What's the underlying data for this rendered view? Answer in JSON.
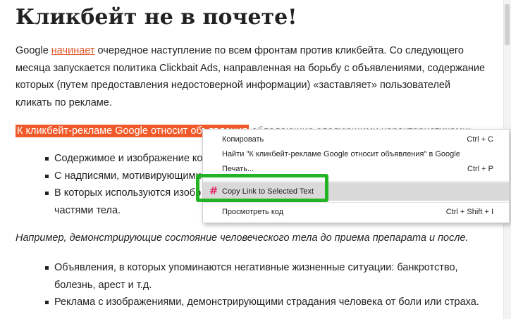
{
  "article": {
    "title": "Кликбейт не в почете!",
    "intro_before_link": "Google ",
    "intro_link": "начинает",
    "intro_after_link": " очередное наступление по всем фронтам против кликбейта. Со следующего месяца запускается политика Clickbait Ads, направленная на борьбу с объявлениями, содержание которых (путем предоставления недостоверной информации) «заставляет» пользователей кликать по рекламе.",
    "highlight_text": "К кликбейт-рекламе Google относит объявления",
    "highlight_tail": " обладающие следующими характеристиками:",
    "list1": [
      "Содержимое и изображение которых",
      "С надписями, мотивирующими",
      "В которых используются изображения частями тела."
    ],
    "list1_item3_line1": "В которых используются изобр",
    "list1_item3_line2": "частями тела.",
    "italic_note": "Например, демонстрирующие состояние человеческого тела до приема препарата и после.",
    "list2": [
      "Объявления, в которых упоминаются негативные жизненные ситуации: банкротство, болезнь, арест и т.д.",
      "Реклама с изображениями, демонстрирующими страдания человека от боли или страха."
    ]
  },
  "context_menu": {
    "items": [
      {
        "label": "Копировать",
        "shortcut": "Ctrl + C"
      },
      {
        "label": "Найти \"К кликбейт-рекламе Google относит объявления\" в Google",
        "shortcut": ""
      },
      {
        "label": "Печать...",
        "shortcut": "Ctrl + P"
      },
      {
        "label": "Copy Link to Selected Text",
        "shortcut": "",
        "icon": "hash-icon"
      },
      {
        "label": "Просмотреть код",
        "shortcut": "Ctrl + Shift + I"
      }
    ]
  },
  "colors": {
    "link": "#e0572a",
    "highlight": "#f05a2a",
    "annotation": "#22b422",
    "hash_icon": "#e0245e"
  }
}
